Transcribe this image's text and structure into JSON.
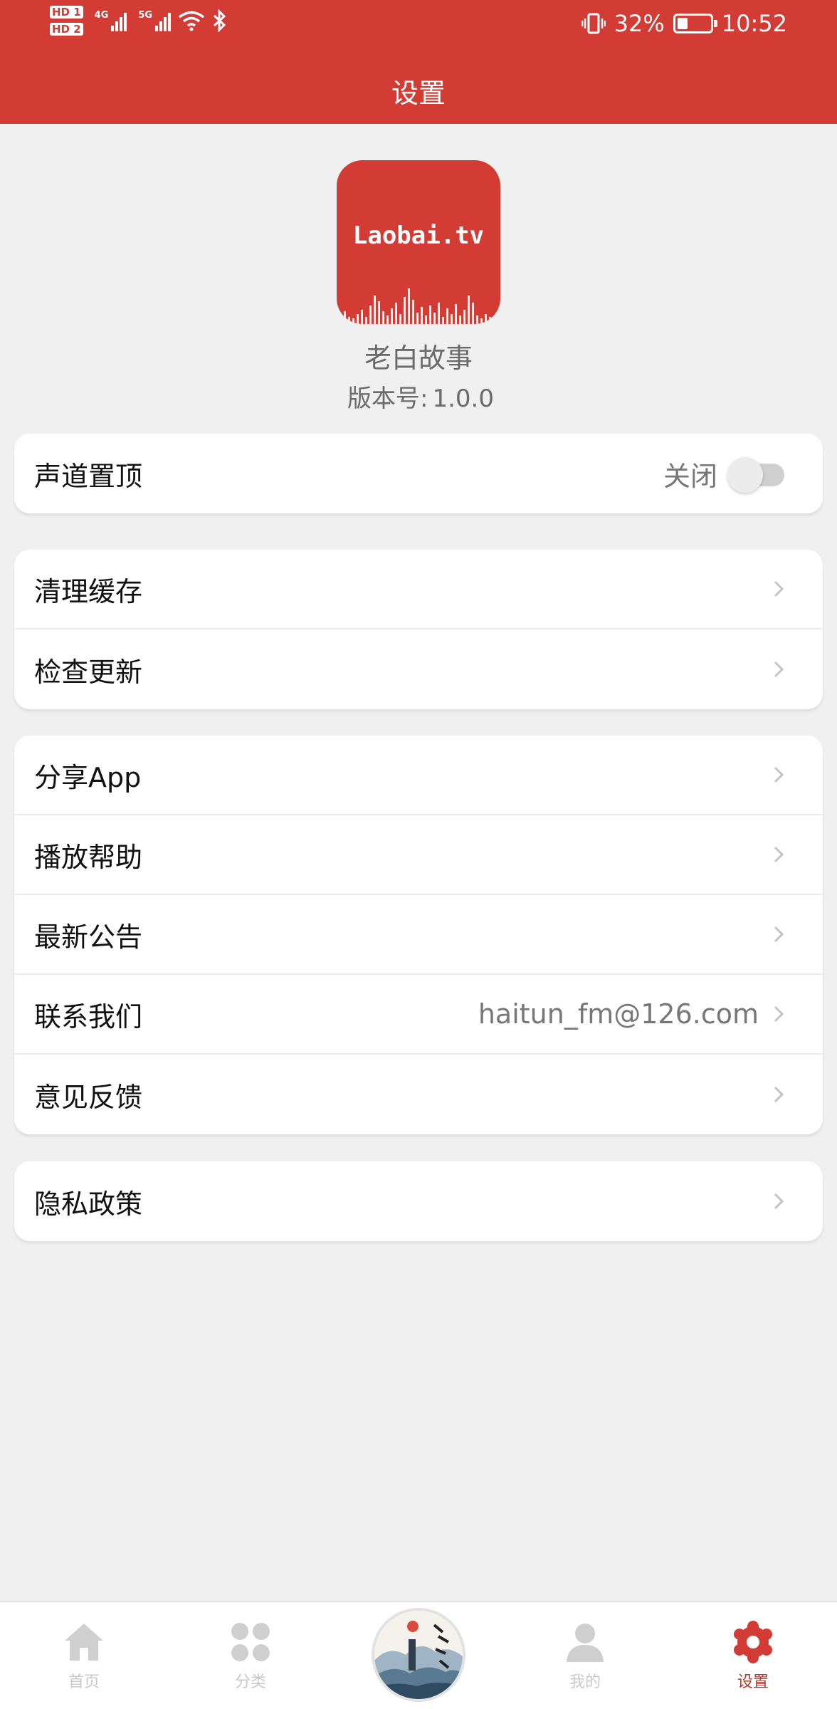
{
  "status": {
    "hd1": "HD 1",
    "hd2": "HD 2",
    "net1": "4G",
    "net2": "5G",
    "battery_percent": "32%",
    "battery_level": 0.32,
    "time": "10:52"
  },
  "header": {
    "title": "设置"
  },
  "app": {
    "icon_text": "Laobai.tv",
    "name": "老白故事",
    "version_label": "版本号:",
    "version": "1.0.0"
  },
  "sections": {
    "channel_top": {
      "label": "声道置顶",
      "value": "关闭",
      "enabled": false
    },
    "cache": {
      "label": "清理缓存"
    },
    "update": {
      "label": "检查更新"
    },
    "share": {
      "label": "分享App"
    },
    "help": {
      "label": "播放帮助"
    },
    "notice": {
      "label": "最新公告"
    },
    "contact": {
      "label": "联系我们",
      "value": "haitun_fm@126.com"
    },
    "feedback": {
      "label": "意见反馈"
    },
    "privacy": {
      "label": "隐私政策"
    }
  },
  "tabbar": {
    "home": "首页",
    "category": "分类",
    "mine": "我的",
    "settings": "设置",
    "active": "settings"
  },
  "colors": {
    "brand": "#d33b35",
    "background": "#f0f0f0",
    "tab_active": "#b33a32",
    "tab_inactive": "#c9c9c9"
  }
}
